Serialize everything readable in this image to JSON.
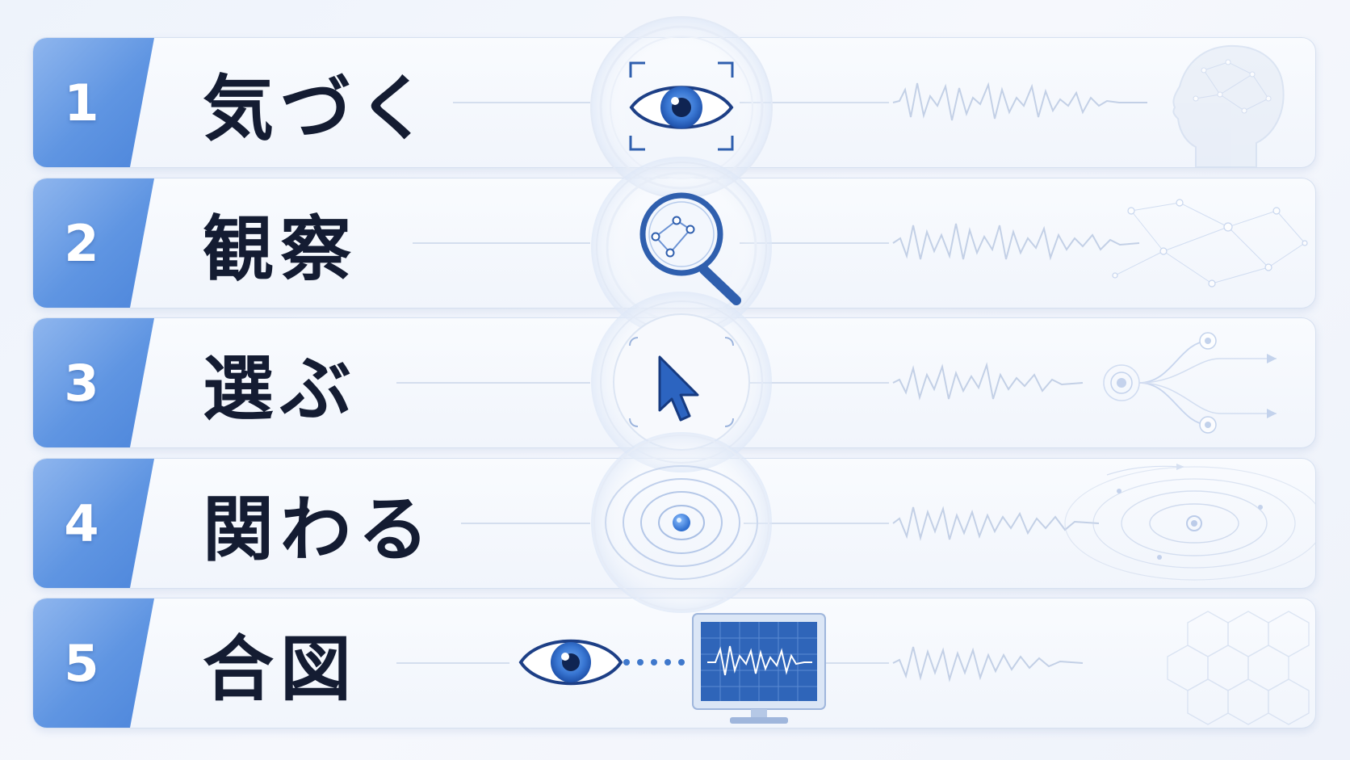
{
  "colors": {
    "accent": "#3f78cc",
    "dark_blue": "#1d3f86",
    "label_text": "#141c32",
    "tab": "#5f95e2"
  },
  "steps": [
    {
      "number": "1",
      "label": "気づく",
      "icon": "eye-icon",
      "decoration": "brain-head-icon"
    },
    {
      "number": "2",
      "label": "観察",
      "icon": "magnifier-icon",
      "decoration": "network-icon"
    },
    {
      "number": "3",
      "label": "選ぶ",
      "icon": "cursor-icon",
      "decoration": "branch-icon"
    },
    {
      "number": "4",
      "label": "関わる",
      "icon": "ripple-icon",
      "decoration": "orbit-icon"
    },
    {
      "number": "5",
      "label": "合図",
      "icon": "eye-monitor-icon",
      "decoration": "hexagon-pattern-icon"
    }
  ]
}
